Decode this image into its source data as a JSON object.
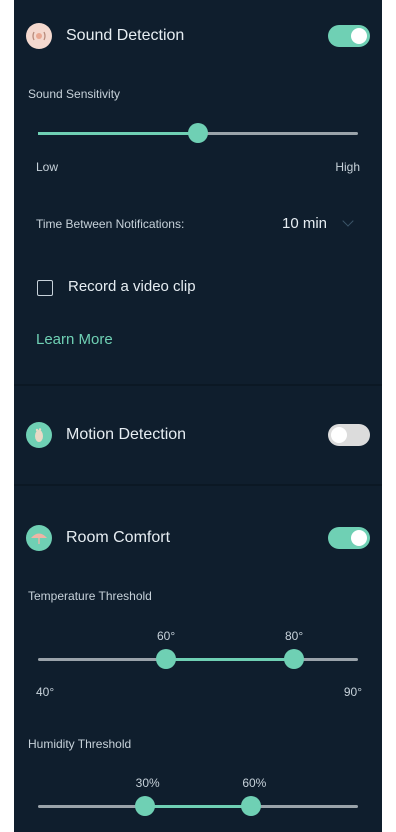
{
  "sound": {
    "title": "Sound Detection",
    "enabled": true,
    "sensitivity_label": "Sound Sensitivity",
    "sensitivity_value": 0.5,
    "low_label": "Low",
    "high_label": "High",
    "notifications_label": "Time Between Notifications:",
    "notifications_value": "10 min",
    "record_clip_label": "Record a video clip",
    "record_clip_checked": false,
    "learn_more": "Learn More"
  },
  "motion": {
    "title": "Motion Detection",
    "enabled": false
  },
  "comfort": {
    "title": "Room Comfort",
    "enabled": true,
    "temperature": {
      "label": "Temperature Threshold",
      "min_label": "40°",
      "max_label": "90°",
      "low_value_label": "60°",
      "high_value_label": "80°",
      "min": 40,
      "max": 90,
      "low": 60,
      "high": 80
    },
    "humidity": {
      "label": "Humidity Threshold",
      "low_value_label": "30%",
      "high_value_label": "60%",
      "min": 0,
      "max": 90,
      "low": 30,
      "high": 60
    }
  },
  "colors": {
    "panel_bg": "#0f1e2d",
    "accent": "#6fd0b4",
    "toggle_off": "#dcdcdc",
    "track": "#9aa3aa",
    "sound_icon": "#f4d9cf",
    "motion_icon": "#e9d9c6",
    "comfort_icon": "#f0b4a5"
  },
  "icons": {
    "sound": "sound-wave-icon",
    "motion": "motion-footprint-icon",
    "comfort": "umbrella-comfort-icon",
    "dropdown": "chevron-down-icon"
  }
}
